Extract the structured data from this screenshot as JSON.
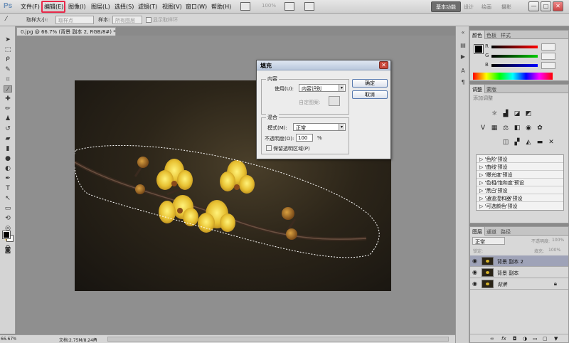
{
  "app": {
    "logo": "Ps"
  },
  "menu": {
    "items": [
      "文件(F)",
      "编辑(E)",
      "图像(I)",
      "图层(L)",
      "选择(S)",
      "滤镜(T)",
      "视图(V)",
      "窗口(W)",
      "帮助(H)"
    ],
    "zoom": "100%",
    "workspaces": {
      "active": "基本功能",
      "others": [
        "设计",
        "绘画",
        "摄影"
      ]
    },
    "window_buttons": [
      "—",
      "□",
      "✕"
    ]
  },
  "options": {
    "tool_icon": "eyedropper-icon",
    "sample_size_label": "取样大小:",
    "sample_size_value": "取样点",
    "sample_label": "样本:",
    "sample_value": "所有图层",
    "show_ring_label": "显示取样环"
  },
  "document": {
    "tab_title": "0.jpg @ 66.7% (背景 副本 2, RGB/8#) *",
    "tab_close": "✕"
  },
  "status": {
    "zoom": "66.67%",
    "doc_info": "文档:2.75M/8.24M",
    "arrow": "▸"
  },
  "panels": {
    "color": {
      "tabs": [
        "颜色",
        "色板",
        "样式"
      ],
      "sliders": [
        "R",
        "G",
        "B"
      ]
    },
    "adjustments": {
      "tabs": [
        "调整",
        "蒙版"
      ],
      "title": "添加调整",
      "presets": [
        "'色阶'预设",
        "'曲线'预设",
        "'曝光度'预设",
        "'色相/饱和度'预设",
        "'黑白'预设",
        "'通道混和器'预设",
        "'可选颜色'预设"
      ]
    },
    "layers": {
      "tabs": [
        "图层",
        "通道",
        "路径"
      ],
      "blend_mode": "正常",
      "opacity_label": "不透明度:",
      "opacity_value": "100%",
      "lock_label": "锁定:",
      "fill_label": "填充:",
      "fill_value": "100%",
      "items": [
        {
          "name": "背景 副本 2",
          "selected": true
        },
        {
          "name": "背景 副本",
          "selected": false
        },
        {
          "name": "背景",
          "selected": false,
          "locked": true
        }
      ],
      "footer_icons": [
        "link-icon",
        "fx",
        "mask-icon",
        "adjustment-icon",
        "folder-icon",
        "new-layer-icon",
        "trash-icon"
      ]
    }
  },
  "dialog": {
    "title": "填充",
    "close": "✕",
    "content_group": "内容",
    "use_label": "使用(U):",
    "use_value": "内容识别",
    "custom_pattern_label": "自定图案:",
    "blend_group": "混合",
    "mode_label": "模式(M):",
    "mode_value": "正常",
    "opacity_label": "不透明度(O):",
    "opacity_value": "100",
    "opacity_unit": "%",
    "preserve_label": "保留透明区域(P)",
    "ok_button": "确定",
    "cancel_button": "取消"
  },
  "colors": {
    "accent_highlight": "#e8294a",
    "selected_layer": "#9fa3b8",
    "flower": "#e8c233"
  }
}
